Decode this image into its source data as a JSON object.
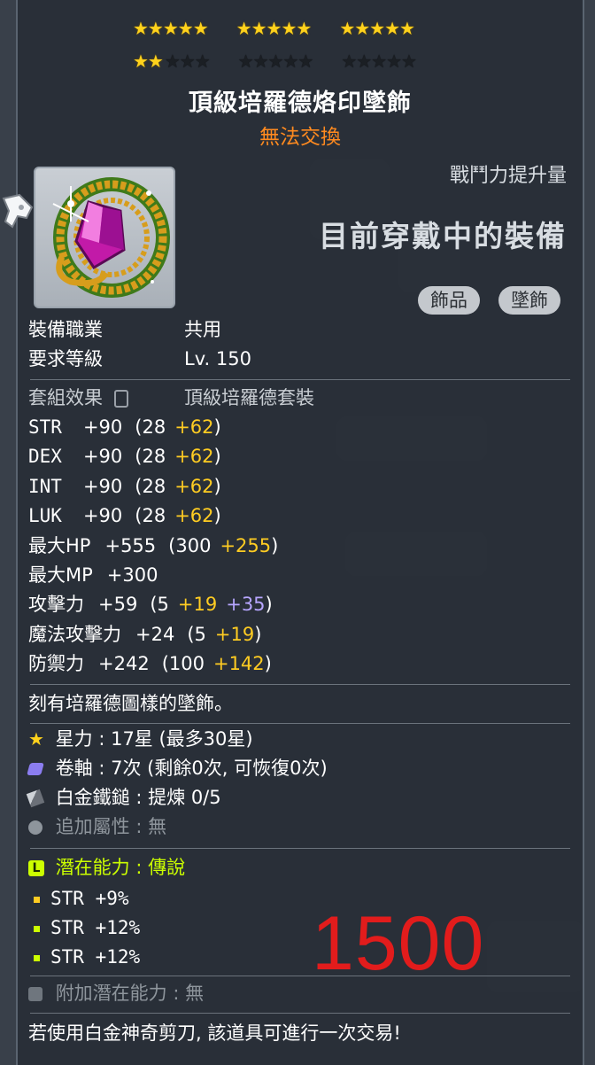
{
  "stars": {
    "filled": 17,
    "max": 30,
    "row1": [
      5,
      5,
      5
    ],
    "row2_filled": [
      2,
      0,
      0
    ]
  },
  "item": {
    "name": "頂級培羅德烙印墜飾",
    "tradeability": "無法交換",
    "combat_label": "戰鬥力提升量",
    "equipped_label": "目前穿戴中的裝備",
    "tags": [
      "飾品",
      "墜飾"
    ]
  },
  "requirements": {
    "job_label": "裝備職業",
    "job_value": "共用",
    "level_label": "要求等級",
    "level_value": "Lv. 150"
  },
  "set": {
    "label": "套組效果",
    "name": "頂級培羅德套裝"
  },
  "stats": [
    {
      "name": "STR",
      "value": "+90",
      "base": "(28",
      "bonus": "+62",
      ")": ")"
    },
    {
      "name": "DEX",
      "value": "+90",
      "base": "(28",
      "bonus": "+62"
    },
    {
      "name": "INT",
      "value": "+90",
      "base": "(28",
      "bonus": "+62"
    },
    {
      "name": "LUK",
      "value": "+90",
      "base": "(28",
      "bonus": "+62"
    },
    {
      "name": "最大HP",
      "value": "+555",
      "base": "(300",
      "bonus": "+255"
    },
    {
      "name": "最大MP",
      "value": "+300"
    },
    {
      "name": "攻擊力",
      "value": "+59",
      "base": "(5",
      "bonus": "+19",
      "extra": "+35"
    },
    {
      "name": "魔法攻擊力",
      "value": "+24",
      "base": "(5",
      "bonus": "+19"
    },
    {
      "name": "防禦力",
      "value": "+242",
      "base": "(100",
      "bonus": "+142"
    }
  ],
  "description": "刻有培羅德圖樣的墜飾。",
  "enhance": {
    "starforce_label": "星力",
    "starforce_value": "17星 (最多30星)",
    "scroll_label": "卷軸",
    "scroll_value": "7次 (剩餘0次, 可恢復0次)",
    "hammer_label": "白金鐵鎚",
    "hammer_value": "提煉 0/5",
    "bonus_label": "追加屬性",
    "bonus_value": "無"
  },
  "potential": {
    "label": "潛在能力",
    "grade": "傳說",
    "lines": [
      "STR +9%",
      "STR +12%",
      "STR +12%"
    ]
  },
  "additional_potential": {
    "label": "附加潛在能力",
    "value": "無"
  },
  "footnote": "若使用白金神奇剪刀, 該道具可進行一次交易!",
  "overlay_price": "1500",
  "colors": {
    "star": "#ffd21c",
    "untradeable": "#ff8a1f",
    "bonus": "#ffcc22",
    "extra": "#b7a6ff",
    "potential": "#ccff00",
    "price": "#e21c1c"
  }
}
